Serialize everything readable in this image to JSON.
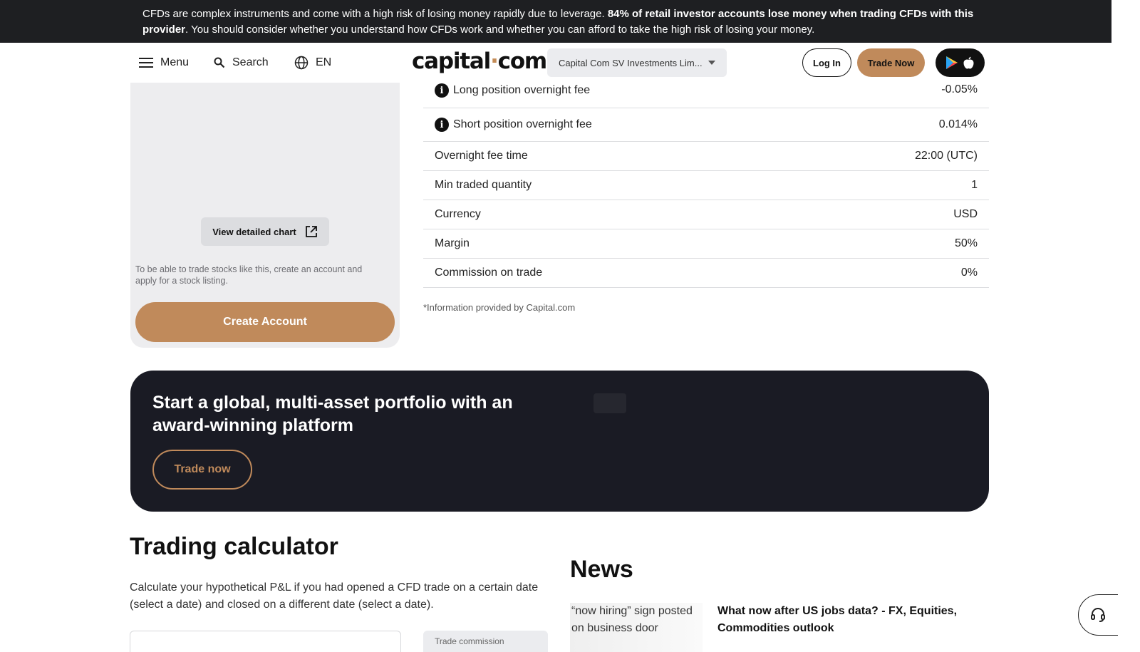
{
  "risk_banner": {
    "text_1": "CFDs are complex instruments and come with a high risk of losing money rapidly due to leverage. ",
    "bold": "84% of retail investor accounts lose money when trading CFDs with this provider",
    "text_2": ". You should consider whether you understand how CFDs work and whether you can afford to take the high risk of losing your money."
  },
  "header": {
    "menu_label": "Menu",
    "search_label": "Search",
    "language_label": "EN",
    "logo_left": "capital",
    "logo_dot": "·",
    "logo_right": "com",
    "entity_select_value": "Capital Com SV Investments Lim...",
    "login_label": "Log In",
    "trade_now_label": "Trade Now",
    "icons": [
      "menu-icon",
      "search-icon",
      "globe-icon",
      "google-play-icon",
      "apple-icon"
    ]
  },
  "left_panel": {
    "chart_button_label": "View detailed chart",
    "note": "To be able to trade stocks like this, create an account and apply for a stock listing.",
    "create_account_label": "Create Account"
  },
  "info_table": {
    "rows": [
      {
        "label": "Long position overnight fee",
        "value": "-0.05%",
        "has_info": true
      },
      {
        "label": "Short position overnight fee",
        "value": "0.014%",
        "has_info": true
      },
      {
        "label": "Overnight fee time",
        "value": "22:00 (UTC)",
        "has_info": false
      },
      {
        "label": "Min traded quantity",
        "value": "1",
        "has_info": false
      },
      {
        "label": "Currency",
        "value": "USD",
        "has_info": false
      },
      {
        "label": "Margin",
        "value": "50%",
        "has_info": false
      },
      {
        "label": "Commission on trade",
        "value": "0%",
        "has_info": false
      }
    ],
    "footnote": "*Information provided by Capital.com"
  },
  "promo": {
    "title": "Start a global, multi-asset portfolio with an award-winning platform",
    "button_label": "Trade now"
  },
  "calculator": {
    "title": "Trading calculator",
    "description": "Calculate your hypothetical P&L if you had opened a CFD trade on a certain date (select a date) and closed on a different date (select a date).",
    "commission_label": "Trade commission"
  },
  "news": {
    "title": "News",
    "image_alt": "“now hiring” sign posted on business door",
    "headline": "What now after US jobs data? - FX, Equities, Commodities outlook"
  },
  "colors": {
    "accent": "#c08a5b",
    "banner_bg": "#1e1f22",
    "promo_bg": "#1a1b24",
    "panel_bg": "#ededef"
  }
}
